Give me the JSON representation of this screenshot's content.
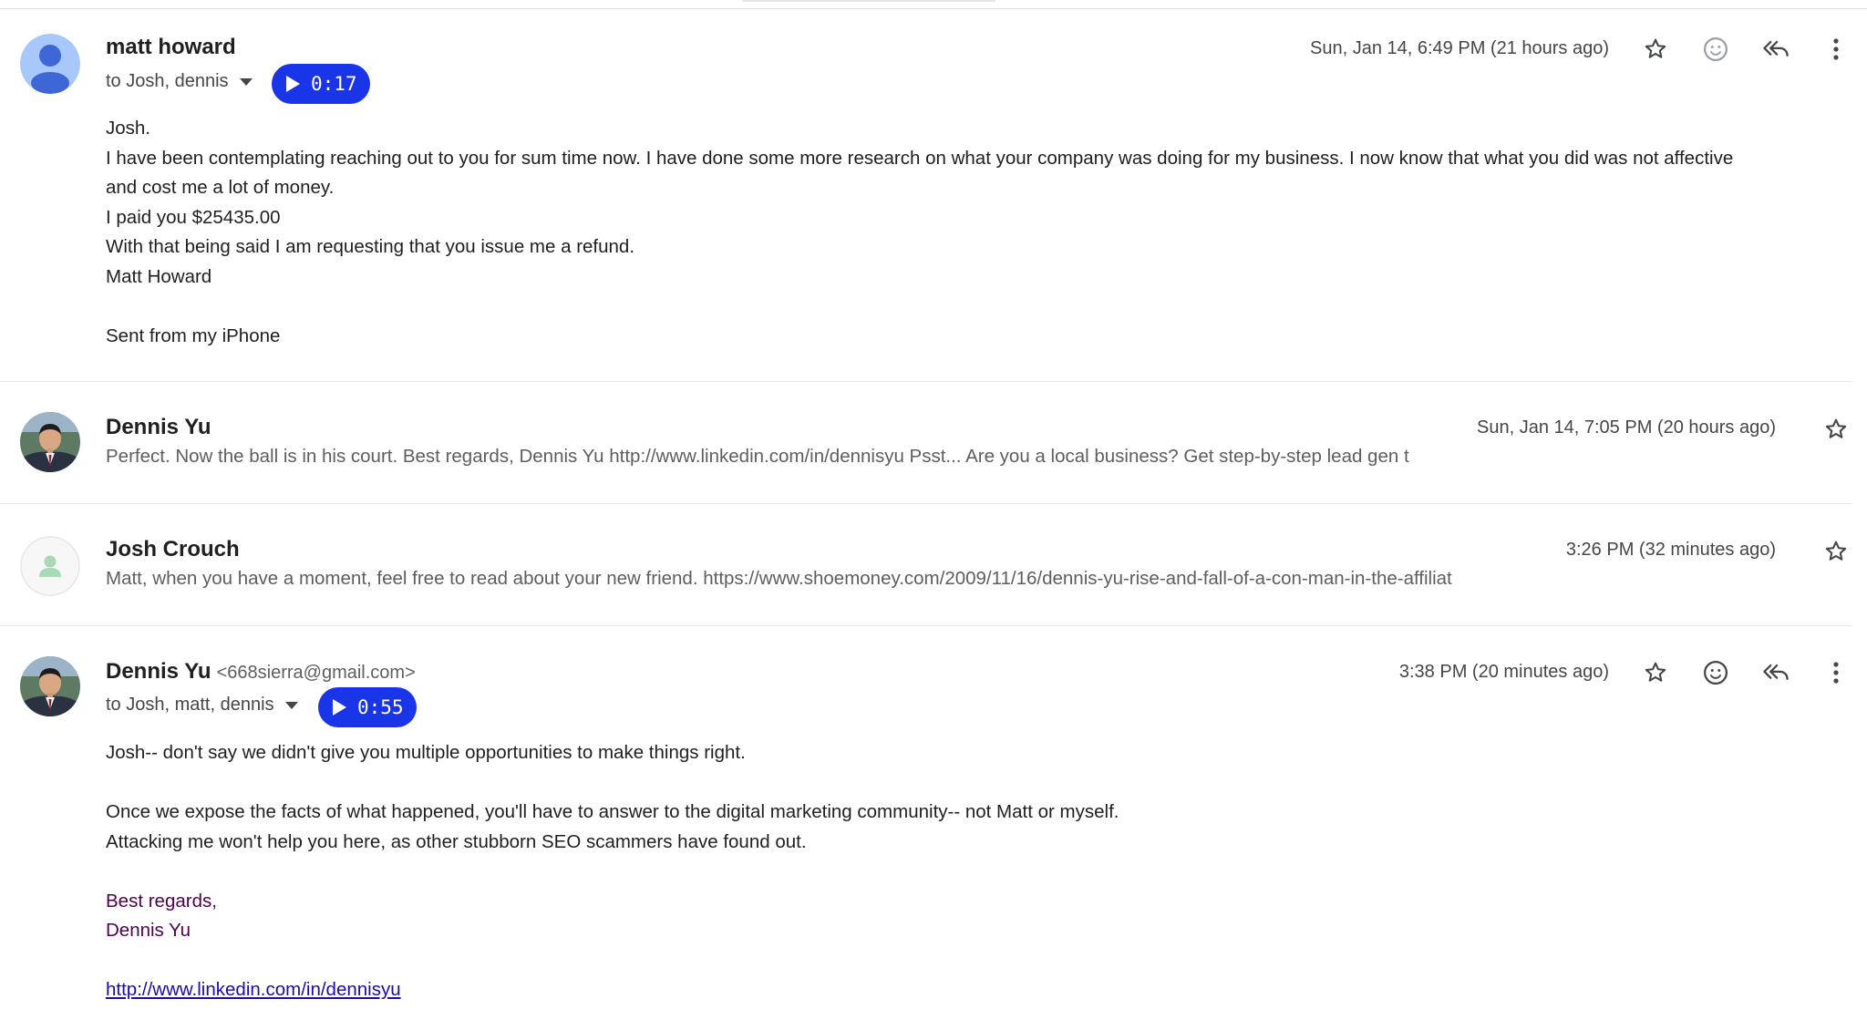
{
  "messages": [
    {
      "sender": "matt howard",
      "to_label": "to Josh, dennis",
      "audio_duration": "0:17",
      "date": "Sun, Jan 14, 6:49 PM (21 hours ago)",
      "body_lines": [
        "Josh.",
        "I have been contemplating reaching out to you for sum time now. I have done some more research on what your company was doing for my business. I now know that what you did was not affective",
        "and cost me a lot of money.",
        "I paid you $25435.00",
        "With that being said I am requesting that you issue me a refund.",
        "Matt Howard",
        "",
        "Sent from my iPhone"
      ]
    },
    {
      "sender": "Dennis Yu",
      "date": "Sun, Jan 14, 7:05 PM (20 hours ago)",
      "snippet": "Perfect. Now the ball is in his court. Best regards, Dennis Yu http://www.linkedin.com/in/dennisyu Psst... Are you a local business? Get step-by-step lead gen t"
    },
    {
      "sender": "Josh Crouch",
      "date": "3:26 PM (32 minutes ago)",
      "snippet": "Matt, when you have a moment, feel free to read about your new friend. https://www.shoemoney.com/2009/11/16/dennis-yu-rise-and-fall-of-a-con-man-in-the-affiliat"
    },
    {
      "sender": "Dennis Yu",
      "sender_email": "<668sierra@gmail.com>",
      "to_label": "to Josh, matt, dennis",
      "audio_duration": "0:55",
      "date": "3:38 PM (20 minutes ago)",
      "body_line1": "Josh-- don't say we didn't give you multiple opportunities to make things right.",
      "body_line2": "Once we expose the facts of what happened, you'll have to answer to the digital marketing community-- not Matt or myself.",
      "body_line3": "Attacking me won't help you here, as other stubborn SEO scammers have found out.",
      "signature_line1": "Best regards,",
      "signature_line2": "Dennis Yu",
      "link": "http://www.linkedin.com/in/dennisyu"
    }
  ],
  "icons": {
    "star": "star-icon",
    "emoji": "emoji-reaction-icon",
    "reply_all": "reply-all-icon",
    "more": "more-vert-icon",
    "avatar_default": "person-icon"
  },
  "colors": {
    "audio_button": "#1a34e8",
    "signature": "#500050",
    "link": "#1a0dab",
    "default_avatar_blue": "#a8c7fa",
    "default_avatar_person_blue": "#3e67d6",
    "josh_avatar_green": "#a8dab5"
  }
}
